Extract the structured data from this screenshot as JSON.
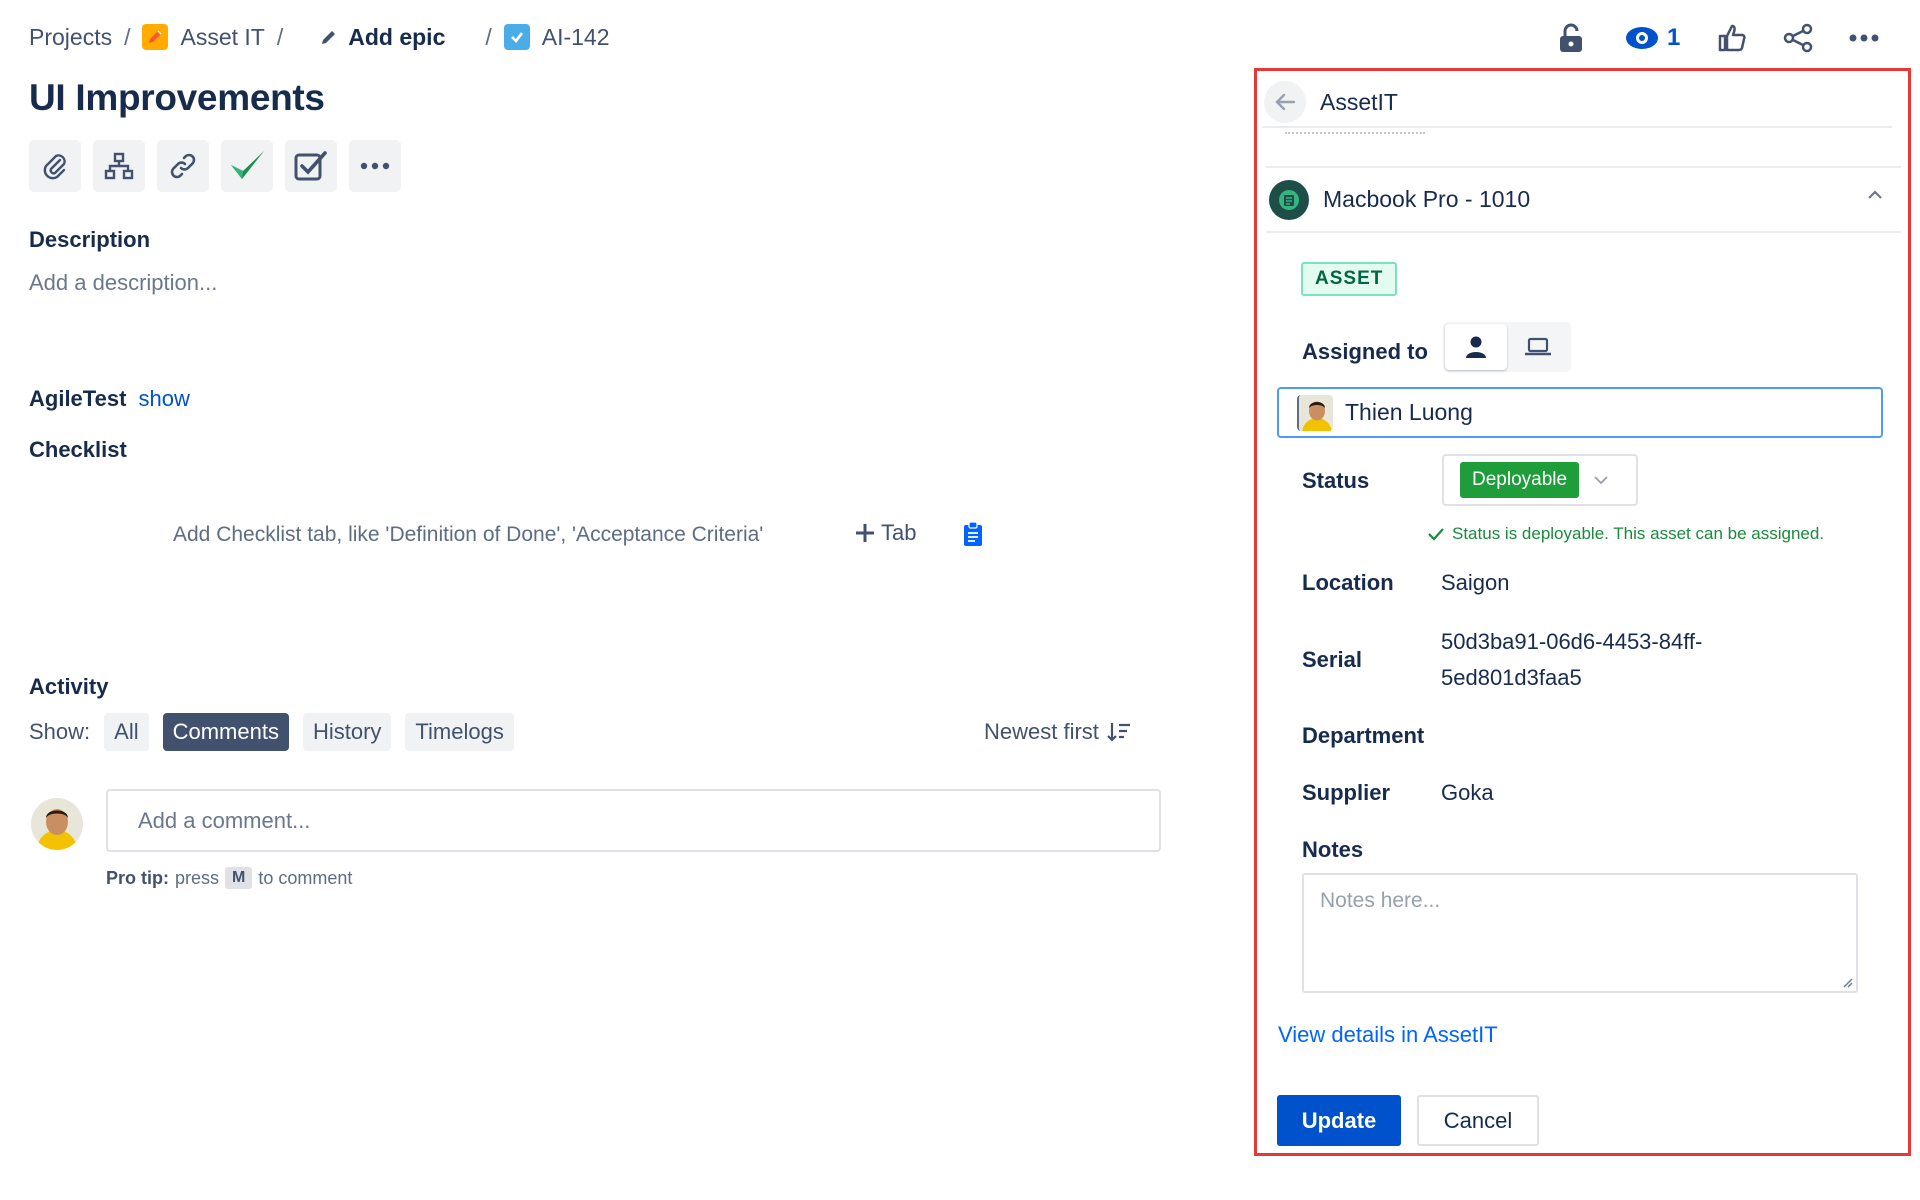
{
  "breadcrumb": {
    "projects": "Projects",
    "project": "Asset IT",
    "epic": "Add epic",
    "issue_key": "AI-142",
    "separator": "/"
  },
  "top_actions": {
    "watchers_count": "1",
    "icons": [
      "lock-icon",
      "eye-icon",
      "thumbs-up-icon",
      "share-icon",
      "more-icon"
    ]
  },
  "issue": {
    "title": "UI Improvements",
    "toolbar_icons": [
      "attachment-icon",
      "child-issue-icon",
      "link-icon",
      "checkmark-icon",
      "checklist-icon",
      "more-icon"
    ]
  },
  "description": {
    "heading": "Description",
    "placeholder": "Add a description..."
  },
  "agiletest": {
    "label": "AgileTest",
    "link": "show"
  },
  "checklist": {
    "heading": "Checklist",
    "hint": "Add Checklist tab, like 'Definition of Done', 'Acceptance Criteria'",
    "add_tab": "Tab"
  },
  "activity": {
    "heading": "Activity",
    "show_label": "Show:",
    "filters": [
      "All",
      "Comments",
      "History",
      "Timelogs"
    ],
    "active_filter": "Comments",
    "sort": "Newest first",
    "comment_placeholder": "Add a comment...",
    "protip_label": "Pro tip:",
    "protip_press": "press",
    "protip_key": "M",
    "protip_suffix": "to comment"
  },
  "panel": {
    "title": "AssetIT",
    "asset_name": "Macbook Pro - 1010",
    "badge": "ASSET",
    "assigned_to_label": "Assigned to",
    "assignee": "Thien Luong",
    "status_label": "Status",
    "status_value": "Deployable",
    "status_message": "Status is deployable. This asset can be assigned.",
    "location_label": "Location",
    "location_value": "Saigon",
    "serial_label": "Serial",
    "serial_line1": "50d3ba91-06d6-4453-84ff-",
    "serial_line2": "5ed801d3faa5",
    "department_label": "Department",
    "supplier_label": "Supplier",
    "supplier_value": "Goka",
    "notes_label": "Notes",
    "notes_placeholder": "Notes here...",
    "view_link": "View details in AssetIT",
    "update_button": "Update",
    "cancel_button": "Cancel"
  },
  "colors": {
    "panel_border": "#e53935",
    "primary": "#0052cc",
    "status_green": "#1f9d3a",
    "badge_bg": "#e3fcef"
  }
}
